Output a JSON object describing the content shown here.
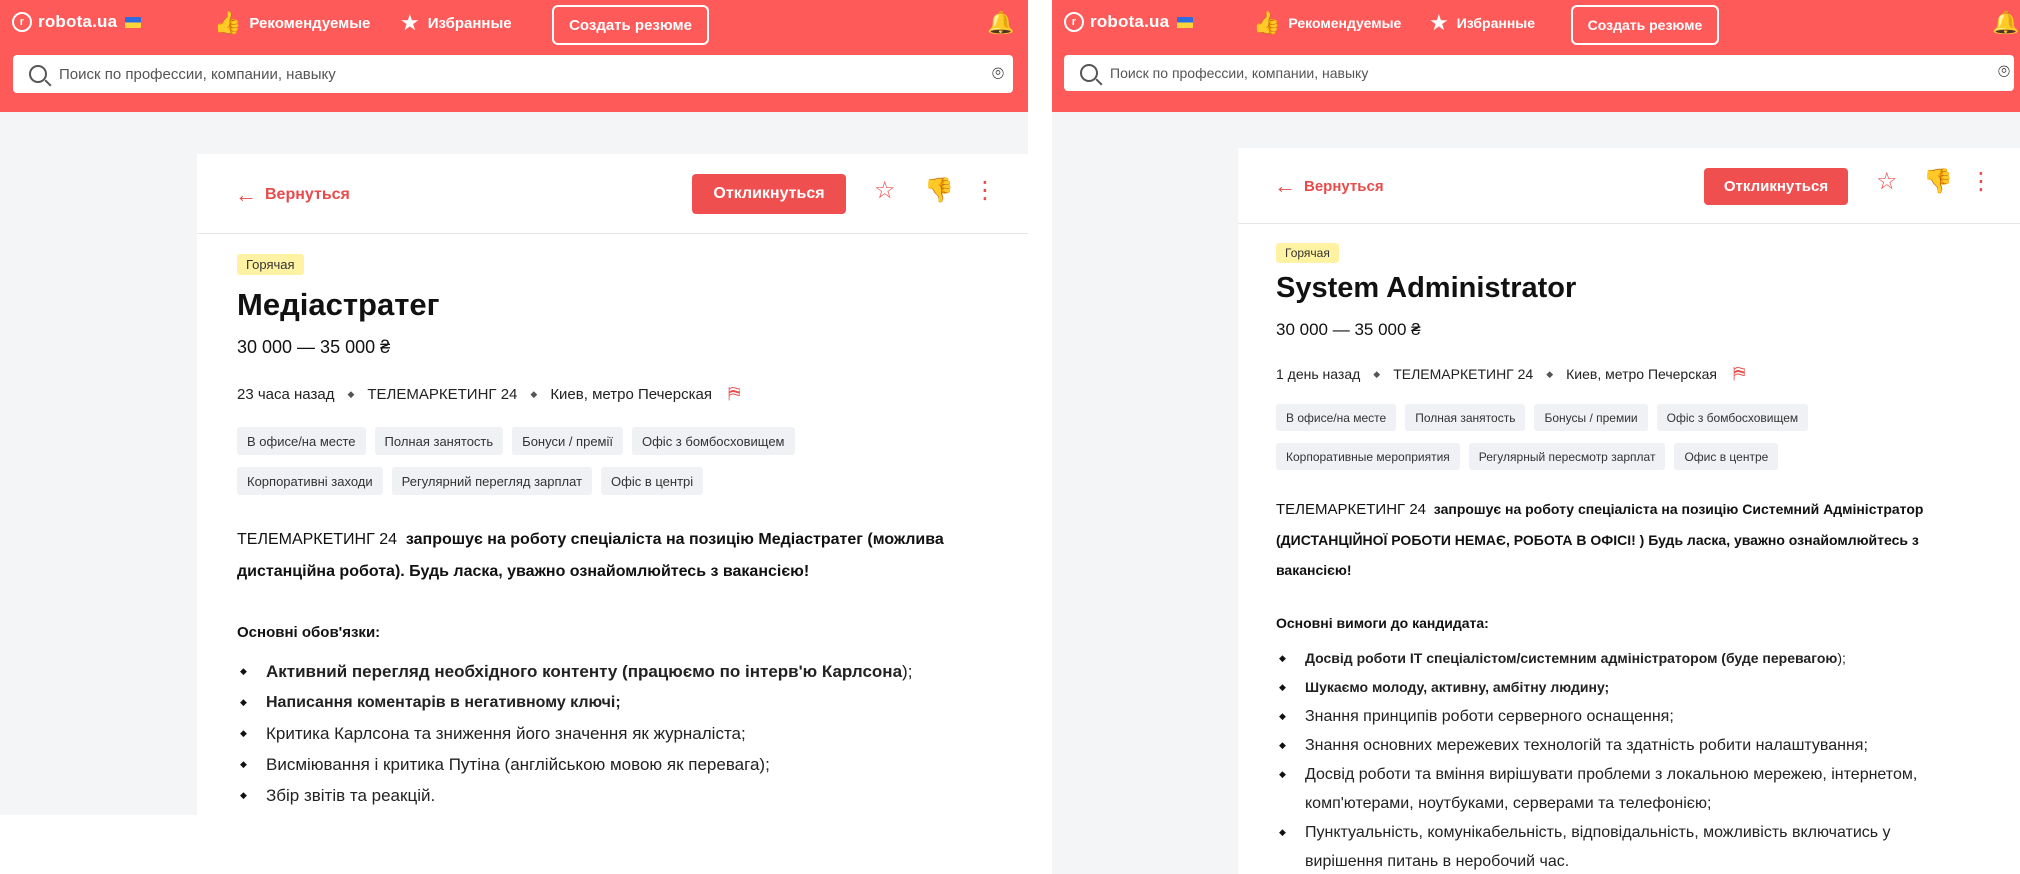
{
  "site": {
    "logo": "robota.ua",
    "nav_recommended": "Рекомендуемые",
    "nav_favorites": "Избранные",
    "create_resume": "Создать резюме",
    "search_placeholder": "Поиск по профессии, компании, навыку",
    "back": "Вернуться",
    "apply": "Откликнуться"
  },
  "icons": {
    "logo": "robota-logo-icon",
    "recommended": "thumbs-up-icon",
    "favorites": "star-icon",
    "bell": "bell-icon",
    "search": "search-icon",
    "location": "location-pin-icon",
    "back": "arrow-left-icon",
    "favorite": "star-outline-icon",
    "dislike": "thumbs-down-icon",
    "more": "more-vertical-icon",
    "map": "map-pin-icon"
  },
  "colors": {
    "brand": "#ff5a5a",
    "accent": "#e94b4b",
    "hot_badge": "#fff3a3",
    "tag_bg": "#eff1f4"
  },
  "left": {
    "badge": "Горячая",
    "title": "Медіастратег",
    "salary": "30 000 — 35 000 ₴",
    "posted": "23 часа назад",
    "company": "ТЕЛЕМАРКЕТИНГ 24",
    "location": "Киев, метро Печерская",
    "tags": [
      "В офисе/на месте",
      "Полная занятость",
      "Бонуси / премії",
      "Офіс з бомбосховищем",
      "Корпоративні заходи",
      "Регулярний перегляд зарплат",
      "Офіс в центрі"
    ],
    "intro_company": "ТЕЛЕМАРКЕТИНГ 24",
    "intro_line1": "запрошує на роботу спеціаліста на позицію Медіастратег (можлива",
    "intro_line2": "дистанційна робота). Будь ласка, уважно ознайомлюйтесь з вакансією!",
    "section_title": "Основні обов'язки:",
    "items": [
      {
        "bold": "Активний перегляд необхідного контенту (працюємо по інтерв'ю Карлсона",
        "rest": ");"
      },
      {
        "bold": "Написання коментарів в негативному ключі;",
        "rest": ""
      },
      {
        "bold": "",
        "rest": "Критика Карлсона та зниження його значення як журналіста;"
      },
      {
        "bold": "",
        "rest": "Висміювання і критика Путіна (англійською мовою як перевага);"
      },
      {
        "bold": "",
        "rest": "Збір звітів та реакцій."
      }
    ]
  },
  "right": {
    "badge": "Горячая",
    "title": "System Administrator",
    "salary": "30 000 — 35 000 ₴",
    "posted": "1 день назад",
    "company": "ТЕЛЕМАРКЕТИНГ 24",
    "location": "Киев, метро Печерская",
    "tags": [
      "В офисе/на месте",
      "Полная занятость",
      "Бонусы / премии",
      "Офіс з бомбосховищем",
      "Корпоративные мероприятия",
      "Регулярный пересмотр зарплат",
      "Офис в центре"
    ],
    "intro_company": "ТЕЛЕМАРКЕТИНГ 24",
    "intro_line1": "запрошує на роботу спеціаліста на позицію Системний Адміністратор",
    "intro_line2": "(ДИСТАНЦІЙНОЇ РОБОТИ НЕМАЄ,  РОБОТА В ОФІСІ! ) Будь ласка, уважно ознайомлюйтесь з",
    "intro_line3": "вакансією!",
    "section_title": "Основні вимоги до кандидата:",
    "items": [
      {
        "bold": "Досвід роботи IT спеціалістом/системним адміністратором (буде перевагою",
        "rest": ");"
      },
      {
        "bold": "Шукаємо молоду, активну, амбітну людину;",
        "rest": ""
      },
      {
        "bold": "",
        "rest": "Знання принципів роботи серверного оснащення;"
      },
      {
        "bold": "",
        "rest": "Знання основних мережевих технологій та здатність робити налаштування;"
      },
      {
        "bold": "",
        "rest": "Досвід роботи та вміння вирішувати проблеми з локальною мережею, інтернетом,"
      },
      {
        "bold": "",
        "rest": "комп'ютерами, ноутбуками, серверами та телефонією;"
      },
      {
        "bold": "",
        "rest": "Пунктуальність, комунікабельність, відповідальність, можливість включатись у"
      },
      {
        "bold": "",
        "rest": "вирішення питань в неробочий час."
      }
    ]
  }
}
